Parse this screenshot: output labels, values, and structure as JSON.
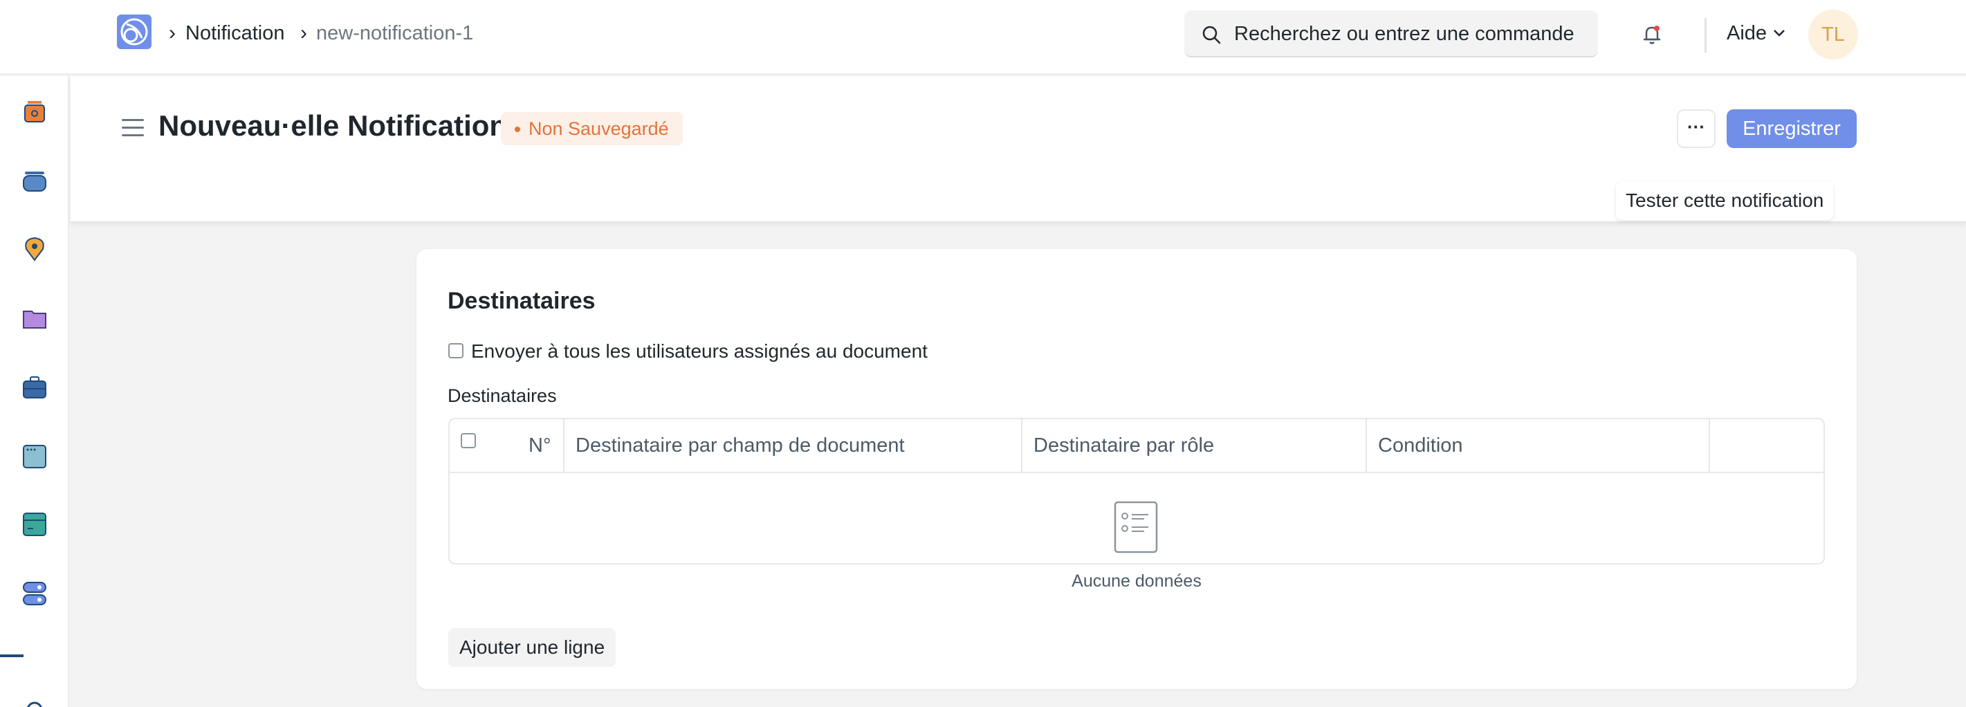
{
  "navbar": {
    "breadcrumbs": [
      "Notification",
      "new-notification-1"
    ],
    "search_placeholder": "Recherchez ou entrez une commande",
    "help_label": "Aide",
    "avatar_initials": "TL",
    "icons": [
      "app-logo-icon",
      "chevron-right-icon",
      "search-icon",
      "bell-icon",
      "chevron-down-icon"
    ]
  },
  "sidebar": {
    "icons": [
      "accounting-icon",
      "buying-icon",
      "map-pin-icon",
      "folder-icon",
      "briefcase-icon",
      "window-icon",
      "terminal-icon",
      "toggle-icon"
    ]
  },
  "page": {
    "title": "Nouveau·elle Notification",
    "status_badge": "Non Sauvegardé",
    "more_label": "···",
    "save_label": "Enregistrer",
    "tooltip": "Tester cette notification"
  },
  "section": {
    "title": "Destinataires",
    "checkbox_label": "Envoyer à tous les utilisateurs assignés au document",
    "checkbox_checked": false,
    "table_label": "Destinataires",
    "columns": [
      "N°",
      "Destinataire par champ de document",
      "Destinataire par rôle",
      "Condition"
    ],
    "rows": [],
    "empty_text": "Aucune données",
    "add_row_label": "Ajouter une ligne"
  },
  "colors": {
    "primary": "#6f8fe8",
    "badge_text": "#e2743a",
    "badge_bg": "#fdf0e8",
    "avatar_text": "#d9a14a",
    "avatar_bg": "#fdf0dd"
  }
}
